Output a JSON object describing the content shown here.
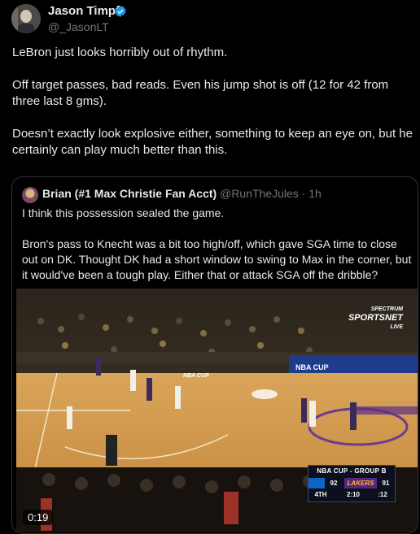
{
  "tweet": {
    "author_name": "Jason Timpf",
    "author_handle": "@_JasonLT",
    "text": "LeBron just looks horribly out of rhythm.\n\nOff target passes, bad reads. Even his jump shot is off (12 for 42 from three last 8 gms).\n\nDoesn’t exactly look explosive either, something to keep an eye on, but he certainly can play much better than this."
  },
  "quoted": {
    "author_name": "Brian (#1 Max Christie Fan Acct)",
    "author_handle": "@RunTheJules",
    "separator": "·",
    "time": "1h",
    "text": "I think this possession sealed the game.\n\nBron's pass to Knecht was a bit too high/off, which gave SGA time to close out on DK. Thought DK had a short window to swing to Max in the corner, but it would've been a tough play. Either that or attack SGA off the dribble?",
    "video": {
      "duration": "0:19",
      "watermark": [
        "SPECTRUM",
        "SPORTSNET",
        "LIVE"
      ],
      "court_logo": "NBA CUP",
      "banner": "NBA CUP",
      "scorebug": {
        "title": "NBA CUP - GROUP B",
        "away_score": "92",
        "home_team": "LAKERS",
        "home_score": "91",
        "quarter": "4TH",
        "clock": "2:10",
        "shot_clock": ":12"
      }
    }
  },
  "colors": {
    "background": "#000000",
    "text": "#e7e9ea",
    "secondary": "#71767b",
    "border": "#2f3336",
    "verified": "#1d9bf0"
  }
}
